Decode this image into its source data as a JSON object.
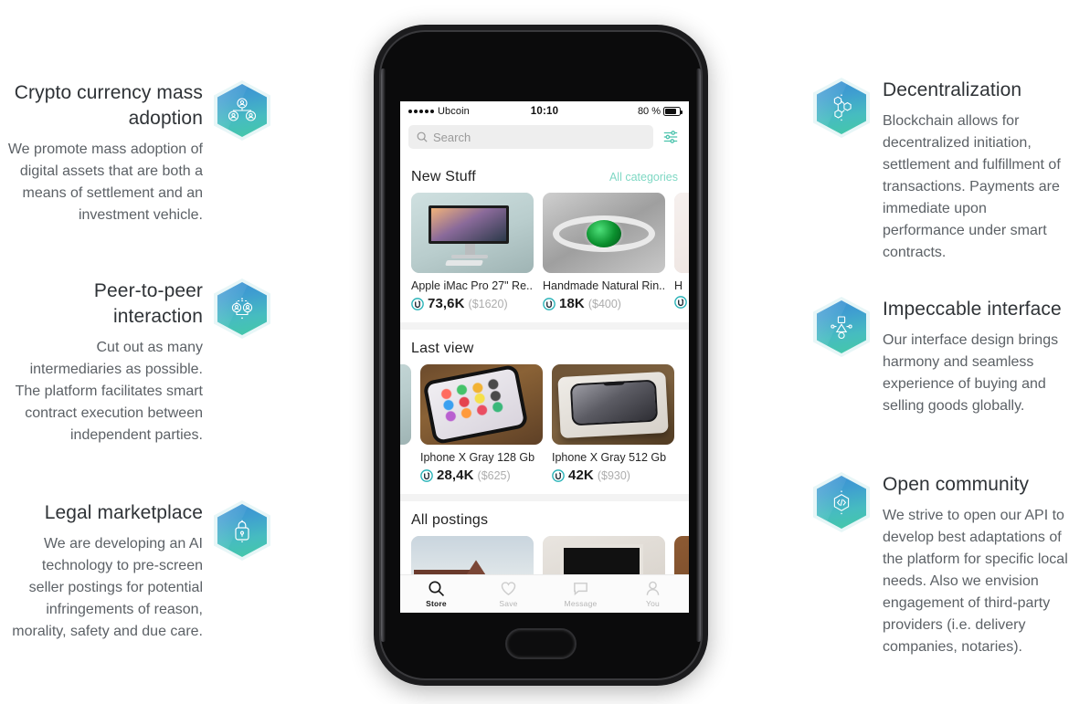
{
  "features_left": [
    {
      "icon": "people-network-icon",
      "title": "Crypto currency mass adoption",
      "body": "We promote mass adoption of digital assets that are both a means of settlement and an investment vehicle."
    },
    {
      "icon": "peer-to-peer-icon",
      "title": "Peer-to-peer interaction",
      "body": "Cut out as many intermediaries as possible. The platform facilitates smart contract execution between independent parties."
    },
    {
      "icon": "lock-icon",
      "title": "Legal marketplace",
      "body": "We are developing an AI technology to pre-screen seller postings for potential infringements of reason, morality, safety and due care."
    }
  ],
  "features_right": [
    {
      "icon": "blockchain-nodes-icon",
      "title": "Decentralization",
      "body": "Blockchain allows for decentralized initiation, settlement and fulfillment of transactions. Payments are immediate upon performance under smart contracts."
    },
    {
      "icon": "shapes-interface-icon",
      "title": "Impeccable interface",
      "body": "Our interface design brings harmony and seamless experience of buying and selling goods globally."
    },
    {
      "icon": "code-brackets-icon",
      "title": "Open community",
      "body": "We strive to open our API to develop best adaptations of the platform for specific local needs. Also we envision engagement of third-party providers (i.e. delivery companies, notaries)."
    }
  ],
  "phone": {
    "status_bar": {
      "signal_dots": 5,
      "carrier": "Ubcoin",
      "time": "10:10",
      "battery_percent": "80 %",
      "battery_level": 80
    },
    "search": {
      "placeholder": "Search",
      "search_icon": "search-icon",
      "filter_icon": "filter-sliders-icon"
    },
    "sections": [
      {
        "title": "New Stuff",
        "link": "All categories",
        "items": [
          {
            "name": "Apple iMac Pro 27\" Re...",
            "coin_price": "73,6K",
            "usd_price": "($1620)",
            "art": "imac"
          },
          {
            "name": "Handmade Natural Rin...",
            "coin_price": "18K",
            "usd_price": "($400)",
            "art": "ring"
          },
          {
            "name": "H",
            "coin_price": "",
            "usd_price": "",
            "art": "pink"
          }
        ]
      },
      {
        "title": "Last view",
        "link": "",
        "items": [
          {
            "name": "...",
            "coin_price": "",
            "usd_price": "",
            "art": "imac"
          },
          {
            "name": "Iphone X Gray 128 Gb",
            "coin_price": "28,4K",
            "usd_price": "($625)",
            "art": "iphone-hand"
          },
          {
            "name": "Iphone X Gray 512 Gb",
            "coin_price": "42K",
            "usd_price": "($930)",
            "art": "iphone-box"
          }
        ]
      },
      {
        "title": "All postings",
        "link": "",
        "items": [
          {
            "name": "",
            "coin_price": "",
            "usd_price": "",
            "art": "house"
          },
          {
            "name": "",
            "coin_price": "",
            "usd_price": "",
            "art": "tv"
          },
          {
            "name": "",
            "coin_price": "",
            "usd_price": "",
            "art": "bag"
          }
        ]
      }
    ],
    "tabbar": [
      {
        "label": "Store",
        "icon": "search-icon",
        "active": true
      },
      {
        "label": "Save",
        "icon": "heart-icon",
        "active": false
      },
      {
        "label": "Message",
        "icon": "chat-icon",
        "active": false
      },
      {
        "label": "You",
        "icon": "person-icon",
        "active": false
      }
    ]
  },
  "colors": {
    "hex_gradient_start": "#3a8fd4",
    "hex_gradient_end": "#44c9a6",
    "accent_mint": "#7fd8c4",
    "coin_teal": "#2bb3b8",
    "title_text": "#2f3337",
    "body_text": "#5c6166"
  }
}
